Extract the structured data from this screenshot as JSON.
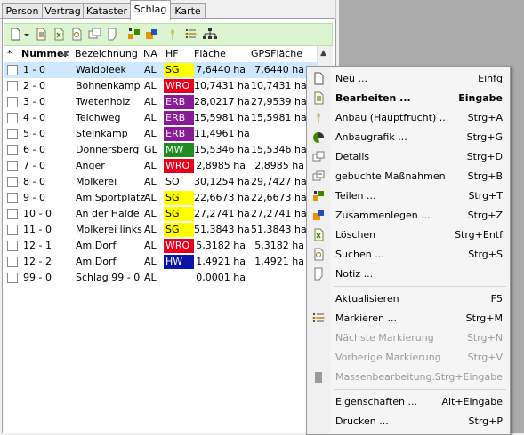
{
  "tabs": [
    "Person",
    "Vertrag",
    "Kataster",
    "Schlag",
    "Karte"
  ],
  "active_tab": "Schlag",
  "table": {
    "headers": {
      "star": "*",
      "nummer": "Nummer",
      "bezeichnung": "Bezeichnung",
      "na": "NA",
      "hf": "HF",
      "flaeche": "Fläche",
      "gpsflaeche": "GPSFläche"
    },
    "rows": [
      {
        "nummer": "1 - 0",
        "bezeichnung": "Waldbleek",
        "na": "AL",
        "hf": "SG",
        "hf_color": "#ffff00",
        "hf_text": "#000000",
        "flaeche": "7,6440 ha",
        "gps": "7,6440 ha"
      },
      {
        "nummer": "2 - 0",
        "bezeichnung": "Bohnenkamp",
        "na": "AL",
        "hf": "WRO",
        "hf_color": "#e8001c",
        "hf_text": "#ffffff",
        "flaeche": "10,7431 ha",
        "gps": "10,7431 ha"
      },
      {
        "nummer": "3 - 0",
        "bezeichnung": "Twetenholz",
        "na": "AL",
        "hf": "ERB",
        "hf_color": "#8b1a9a",
        "hf_text": "#ffffff",
        "flaeche": "28,0217 ha",
        "gps": "27,9539 ha"
      },
      {
        "nummer": "4 - 0",
        "bezeichnung": "Teichweg",
        "na": "AL",
        "hf": "ERB",
        "hf_color": "#8b1a9a",
        "hf_text": "#ffffff",
        "flaeche": "15,5981 ha",
        "gps": "15,5981 ha"
      },
      {
        "nummer": "5 - 0",
        "bezeichnung": "Steinkamp",
        "na": "AL",
        "hf": "ERB",
        "hf_color": "#8b1a9a",
        "hf_text": "#ffffff",
        "flaeche": "11,4961 ha",
        "gps": ""
      },
      {
        "nummer": "6 - 0",
        "bezeichnung": "Donnersberg",
        "na": "GL",
        "hf": "MW",
        "hf_color": "#1e8c1e",
        "hf_text": "#ffffff",
        "flaeche": "15,5346 ha",
        "gps": "15,5346 ha"
      },
      {
        "nummer": "7 - 0",
        "bezeichnung": "Anger",
        "na": "AL",
        "hf": "WRO",
        "hf_color": "#e8001c",
        "hf_text": "#ffffff",
        "flaeche": "2,8985 ha",
        "gps": "2,8985 ha"
      },
      {
        "nummer": "8 - 0",
        "bezeichnung": "Molkerei",
        "na": "AL",
        "hf": "SO",
        "hf_color": "#ffffff",
        "hf_text": "#000000",
        "flaeche": "30,1254 ha",
        "gps": "29,7427 ha"
      },
      {
        "nummer": "9 - 0",
        "bezeichnung": "Am Sportplatz",
        "na": "AL",
        "hf": "SG",
        "hf_color": "#ffff00",
        "hf_text": "#000000",
        "flaeche": "22,6673 ha",
        "gps": "22,6673 ha"
      },
      {
        "nummer": "10 - 0",
        "bezeichnung": "An der Halde",
        "na": "AL",
        "hf": "SG",
        "hf_color": "#ffff00",
        "hf_text": "#000000",
        "flaeche": "27,2741 ha",
        "gps": "27,2741 ha"
      },
      {
        "nummer": "11 - 0",
        "bezeichnung": "Molkerei links",
        "na": "AL",
        "hf": "SG",
        "hf_color": "#ffff00",
        "hf_text": "#000000",
        "flaeche": "51,3843 ha",
        "gps": "51,3843 ha"
      },
      {
        "nummer": "12 - 1",
        "bezeichnung": "Am Dorf",
        "na": "AL",
        "hf": "WRO",
        "hf_color": "#e8001c",
        "hf_text": "#ffffff",
        "flaeche": "5,3182 ha",
        "gps": "5,3182 ha"
      },
      {
        "nummer": "12 - 2",
        "bezeichnung": "Am Dorf",
        "na": "AL",
        "hf": "HW",
        "hf_color": "#0a14a8",
        "hf_text": "#ffffff",
        "flaeche": "1,4921 ha",
        "gps": "1,4921 ha"
      },
      {
        "nummer": "99 - 0",
        "bezeichnung": "Schlag 99 - 0",
        "na": "AL",
        "hf": "",
        "hf_color": "#ffffff",
        "hf_text": "#000000",
        "flaeche": "0,0001 ha",
        "gps": ""
      }
    ]
  },
  "context_menu": {
    "items": [
      {
        "label": "Neu ...",
        "shortcut": "Einfg",
        "icon": "new-document-icon",
        "bold": false,
        "disabled": false
      },
      {
        "label": "Bearbeiten ...",
        "shortcut": "Eingabe",
        "icon": "edit-document-icon",
        "bold": true,
        "disabled": false
      },
      {
        "label": "Anbau (Hauptfrucht) ...",
        "shortcut": "Strg+A",
        "icon": "crop-plant-icon",
        "bold": false,
        "disabled": false
      },
      {
        "label": "Anbaugrafik ...",
        "shortcut": "Strg+G",
        "icon": "pie-chart-icon",
        "bold": false,
        "disabled": false
      },
      {
        "label": "Details",
        "shortcut": "Strg+D",
        "icon": "details-icon",
        "bold": false,
        "disabled": false
      },
      {
        "label": "gebuchte Maßnahmen",
        "shortcut": "Strg+B",
        "icon": "booked-measures-icon",
        "bold": false,
        "disabled": false
      },
      {
        "label": "Teilen ...",
        "shortcut": "Strg+T",
        "icon": "split-icon",
        "bold": false,
        "disabled": false
      },
      {
        "label": "Zusammenlegen ...",
        "shortcut": "Strg+Z",
        "icon": "merge-icon",
        "bold": false,
        "disabled": false
      },
      {
        "label": "Löschen",
        "shortcut": "Strg+Entf",
        "icon": "delete-icon",
        "bold": false,
        "disabled": false
      },
      {
        "label": "Suchen ...",
        "shortcut": "Strg+S",
        "icon": "search-icon",
        "bold": false,
        "disabled": false
      },
      {
        "label": "Notiz ...",
        "shortcut": "",
        "icon": "note-icon",
        "bold": false,
        "disabled": false
      },
      {
        "label": "Aktualisieren",
        "shortcut": "F5",
        "icon": "",
        "bold": false,
        "disabled": false
      },
      {
        "label": "Markieren ...",
        "shortcut": "Strg+M",
        "icon": "mark-icon",
        "bold": false,
        "disabled": false
      },
      {
        "label": "Nächste Markierung",
        "shortcut": "Strg+N",
        "icon": "",
        "bold": false,
        "disabled": true
      },
      {
        "label": "Vorherige Markierung",
        "shortcut": "Strg+V",
        "icon": "",
        "bold": false,
        "disabled": true
      },
      {
        "label": "Massenbearbeitung...",
        "shortcut": "Strg+Eingabe",
        "icon": "bulk-edit-icon",
        "bold": false,
        "disabled": true
      },
      {
        "label": "Eigenschaften ...",
        "shortcut": "Alt+Eingabe",
        "icon": "",
        "bold": false,
        "disabled": false
      },
      {
        "label": "Drucken ...",
        "shortcut": "Strg+P",
        "icon": "",
        "bold": false,
        "disabled": false
      }
    ]
  }
}
